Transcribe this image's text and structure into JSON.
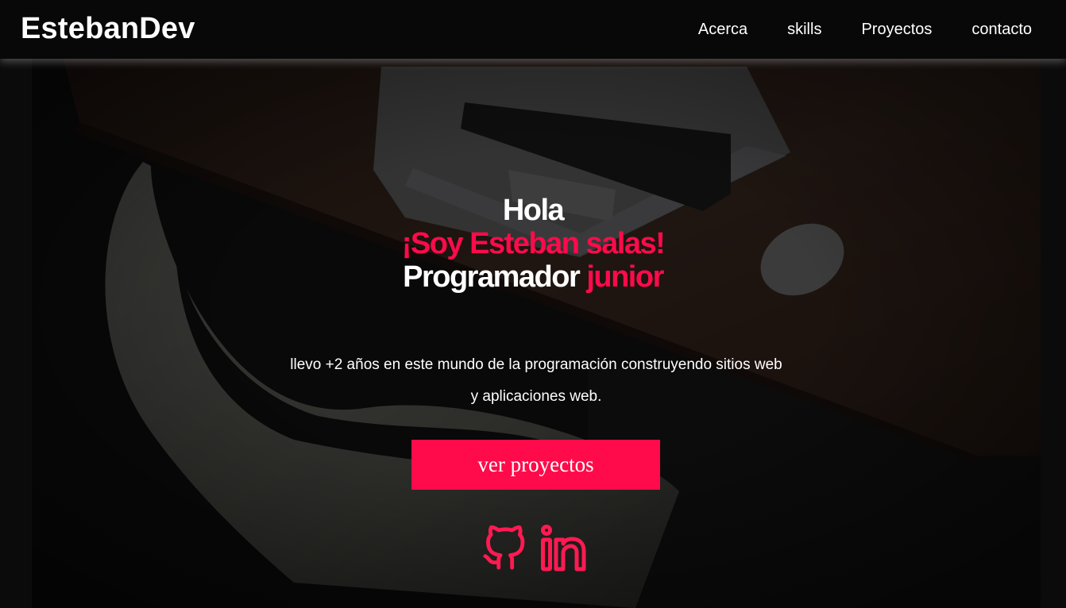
{
  "header": {
    "logo": "EstebanDev",
    "nav": [
      "Acerca",
      "skills",
      "Proyectos",
      "contacto"
    ]
  },
  "hero": {
    "greeting": "Hola",
    "name_line": "¡Soy Esteban salas!",
    "role_word": "Programador",
    "role_accent": "junior",
    "description": "llevo +2 años en este mundo de la programación construyendo sitios web y aplicaciones web.",
    "cta_label": "ver proyectos",
    "social_icons": [
      "github-icon",
      "linkedin-icon"
    ]
  },
  "colors": {
    "accent": "#ff0a4a",
    "header_bg": "#080808",
    "page_bg": "#0b0b0b"
  }
}
